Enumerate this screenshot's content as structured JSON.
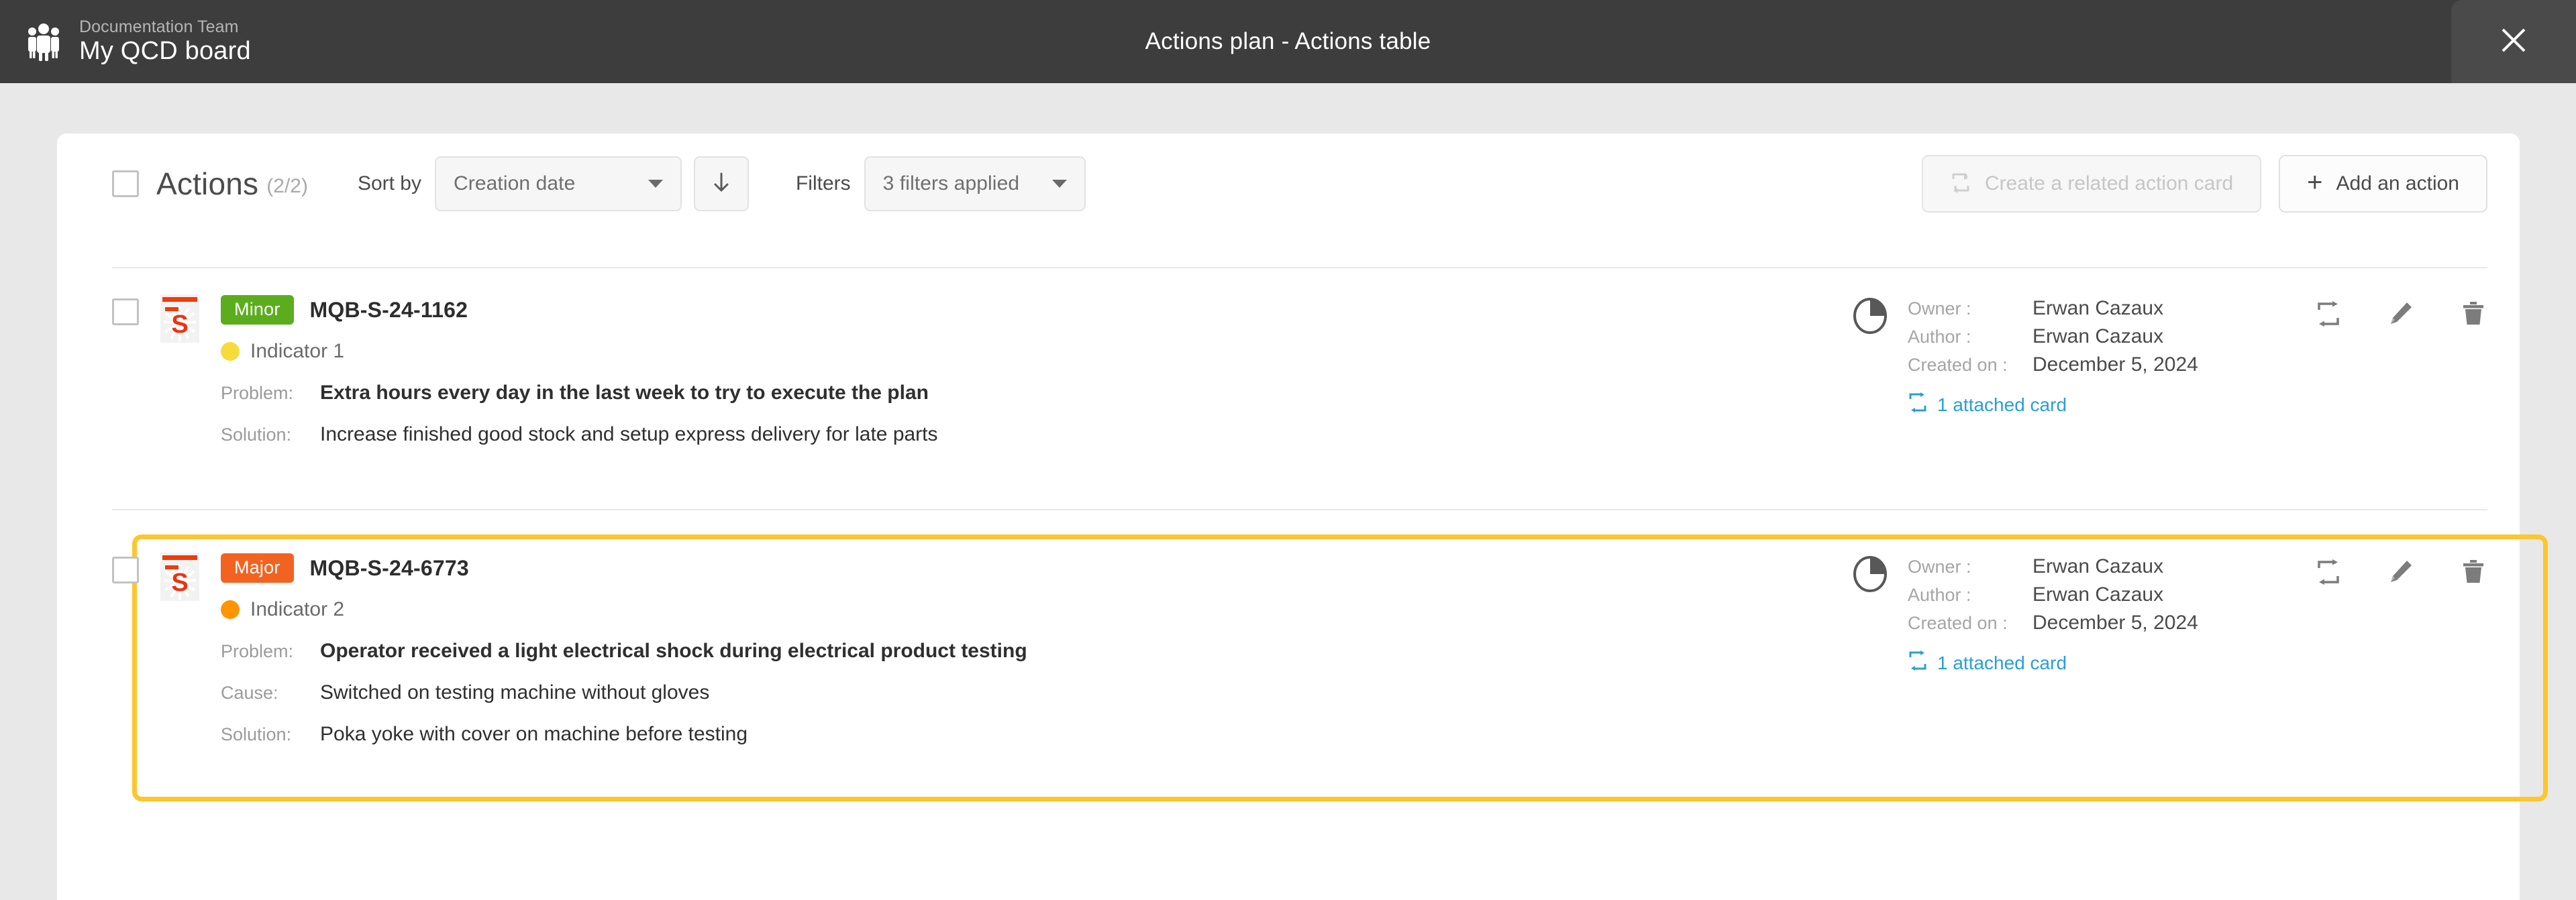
{
  "topbar": {
    "team": "Documentation Team",
    "board": "My QCD board",
    "title": "Actions plan - Actions table",
    "close_icon": "close-icon",
    "brand_icon": "team-group-icon"
  },
  "toolbar": {
    "title": "Actions",
    "count": "(2/2)",
    "sort_by_label": "Sort by",
    "sort_by_value": "Creation date",
    "sort_direction_icon": "arrow-down-icon",
    "filters_label": "Filters",
    "filters_value": "3 filters applied",
    "create_related_label": "Create a related action card",
    "create_related_icon": "related-card-icon",
    "add_action_label": "Add an action",
    "add_action_icon": "plus-icon"
  },
  "colors": {
    "minor_badge": "#5CAD1E",
    "major_badge": "#F26322",
    "indicator_1": "#F5DC3C",
    "indicator_2": "#FF9500",
    "highlight_border": "#FDC62E",
    "link": "#2a9fd4",
    "card_accent": "#EE3C0A"
  },
  "labels": {
    "problem": "Problem:",
    "cause": "Cause:",
    "solution": "Solution:",
    "owner": "Owner :",
    "author": "Author :",
    "created_on": "Created on :"
  },
  "rows": [
    {
      "card_letter": "S",
      "severity": "Minor",
      "severity_color": "#5CAD1E",
      "reference": "MQB-S-24-1162",
      "indicator": "Indicator 1",
      "indicator_color": "#F5DC3C",
      "problem": "Extra hours every day in the last week to try to execute the plan",
      "cause": null,
      "solution": "Increase finished good stock and setup express delivery for late parts",
      "owner": "Erwan Cazaux",
      "author": "Erwan Cazaux",
      "created_on": "December 5, 2024",
      "attached": "1 attached card",
      "highlighted": false
    },
    {
      "card_letter": "S",
      "severity": "Major",
      "severity_color": "#F26322",
      "reference": "MQB-S-24-6773",
      "indicator": "Indicator 2",
      "indicator_color": "#FF9500",
      "problem": "Operator received a light electrical shock during electrical product testing",
      "cause": "Switched on testing machine without gloves",
      "solution": "Poka yoke with cover on machine before testing",
      "owner": "Erwan Cazaux",
      "author": "Erwan Cazaux",
      "created_on": "December 5, 2024",
      "attached": "1 attached card",
      "highlighted": true
    }
  ]
}
